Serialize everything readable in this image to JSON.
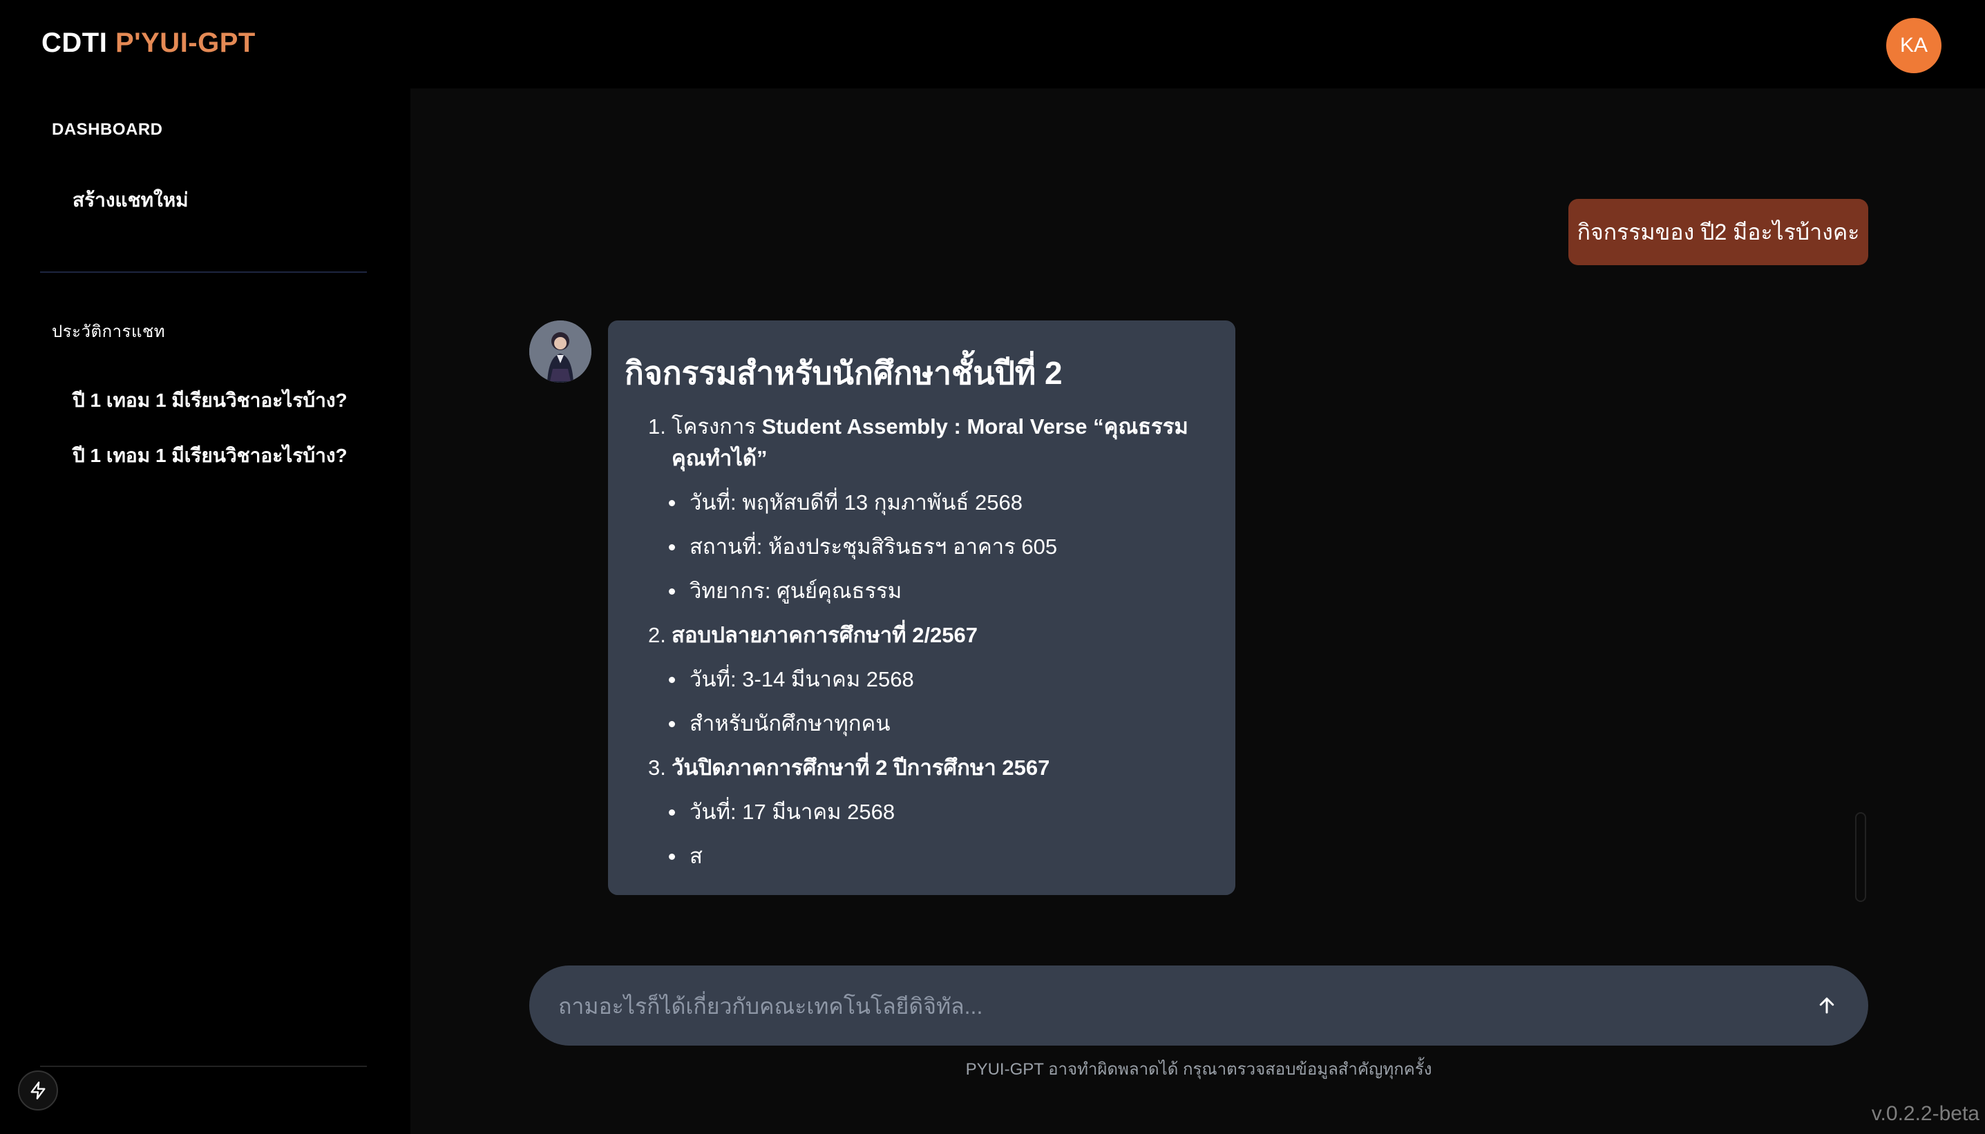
{
  "header": {
    "brand_prefix": "CDTI ",
    "brand_accent": "P'YUI-GPT",
    "avatar_initials": "KA"
  },
  "sidebar": {
    "dashboard_heading": "DASHBOARD",
    "new_chat": "สร้างแชทใหม่",
    "history_heading": "ประวัติการแชท",
    "history": [
      "ปี 1 เทอม 1 มีเรียนวิชาอะไรบ้าง?",
      "ปี 1 เทอม 1 มีเรียนวิชาอะไรบ้าง?"
    ],
    "bolt_icon": "bolt-icon"
  },
  "chat": {
    "user_message": "กิจกรรมของ ปี2 มีอะไรบ้างคะ",
    "bot_title": "กิจกรรมสำหรับนักศึกษาชั้นปีที่ 2",
    "items": [
      {
        "num": "1.",
        "title_prefix": "โครงการ ",
        "title_bold": "Student Assembly : Moral Verse “คุณธรรมคุณทำได้”",
        "subs": [
          "วันที่: พฤหัสบดีที่ 13 กุมภาพันธ์ 2568",
          "สถานที่: ห้องประชุมสิรินธรฯ อาคาร 605",
          "วิทยากร: ศูนย์คุณธรรม"
        ]
      },
      {
        "num": "2.",
        "title_prefix": "",
        "title_bold": "สอบปลายภาคการศึกษาที่ 2/2567",
        "subs": [
          "วันที่: 3-14 มีนาคม 2568",
          "สำหรับนักศึกษาทุกคน"
        ]
      },
      {
        "num": "3.",
        "title_prefix": "",
        "title_bold": "วันปิดภาคการศึกษาที่ 2 ปีการศึกษา 2567",
        "subs": [
          "วันที่: 17 มีนาคม 2568",
          "ส"
        ]
      }
    ]
  },
  "input": {
    "placeholder": "ถามอะไรก็ได้เกี่ยวกับคณะเทคโนโลยีดิจิทัล...",
    "value": ""
  },
  "disclaimer": "PYUI-GPT อาจทำผิดพลาดได้ กรุณาตรวจสอบข้อมูลสำคัญทุกครั้ง",
  "version": "v.0.2.2-beta",
  "colors": {
    "accent": "#e58a55",
    "avatar": "#ef7a36",
    "user_bubble": "#7a3420",
    "bot_bubble": "#373f4d",
    "input_bg": "#373f4d"
  }
}
